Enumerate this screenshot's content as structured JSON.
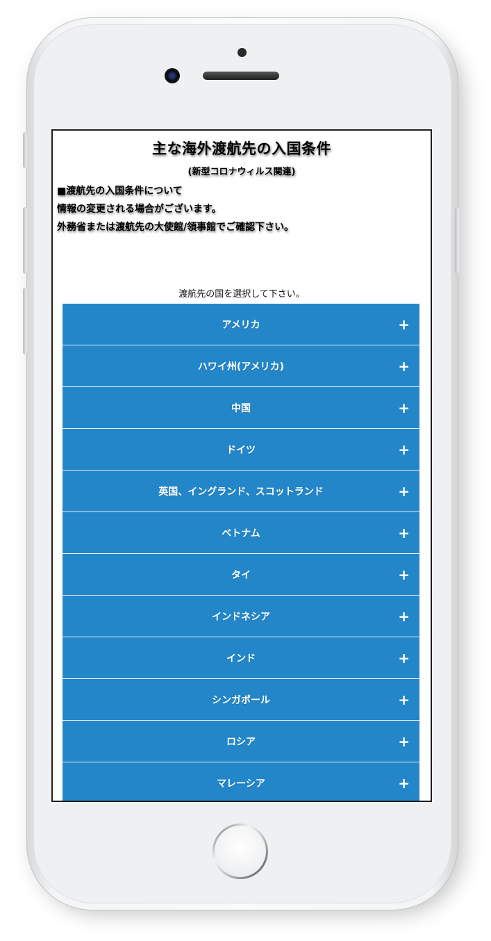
{
  "page": {
    "title": "主な海外渡航先の入国条件",
    "subtitle": "(新型コロナウィルス関連)",
    "info_lines": [
      "■渡航先の入国条件について",
      "情報の変更される場合がございます。",
      "外務省または渡航先の大使館/領事館でご確認下さい。"
    ],
    "select_prompt": "渡航先の国を選択して下さい。"
  },
  "countries": [
    {
      "label": "アメリカ",
      "icon": "plus-icon"
    },
    {
      "label": "ハワイ州(アメリカ)",
      "icon": "plus-icon"
    },
    {
      "label": "中国",
      "icon": "plus-icon"
    },
    {
      "label": "ドイツ",
      "icon": "plus-icon"
    },
    {
      "label": "英国、イングランド、スコットランド",
      "icon": "plus-icon"
    },
    {
      "label": "ベトナム",
      "icon": "plus-icon"
    },
    {
      "label": "タイ",
      "icon": "plus-icon"
    },
    {
      "label": "インドネシア",
      "icon": "plus-icon"
    },
    {
      "label": "インド",
      "icon": "plus-icon"
    },
    {
      "label": "シンガポール",
      "icon": "plus-icon"
    },
    {
      "label": "ロシア",
      "icon": "plus-icon"
    },
    {
      "label": "マレーシア",
      "icon": "plus-icon"
    }
  ],
  "plus_glyph": "+",
  "colors": {
    "accordion_bg": "#2386c9",
    "accordion_text": "#ffffff",
    "screen_border": "#1e1e1e"
  }
}
